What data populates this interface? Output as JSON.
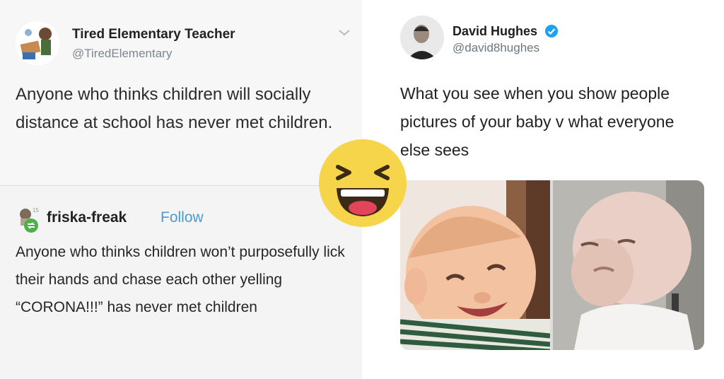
{
  "tweet_top": {
    "name": "Tired Elementary Teacher",
    "handle": "@TiredElementary",
    "text": "Anyone who thinks children will socially distance at school has never met children."
  },
  "tumblr_post": {
    "name": "friska-freak",
    "follow_label": "Follow",
    "text": "Anyone who thinks children won’t purposefully lick their hands and chase each other yelling “CORONA!!!” has never met children"
  },
  "tweet_right": {
    "name": "David Hughes",
    "handle": "@david8hughes",
    "text": "What you see when you show people pictures of your baby v what everyone else sees"
  },
  "colors": {
    "follow_blue": "#4b9bd3",
    "verified_blue": "#1da1f2",
    "emoji_yellow": "#f6d54a"
  },
  "icons": [
    "chevron-down-icon",
    "verified-badge-icon",
    "laughing-emoji-icon",
    "reblog-icon"
  ]
}
